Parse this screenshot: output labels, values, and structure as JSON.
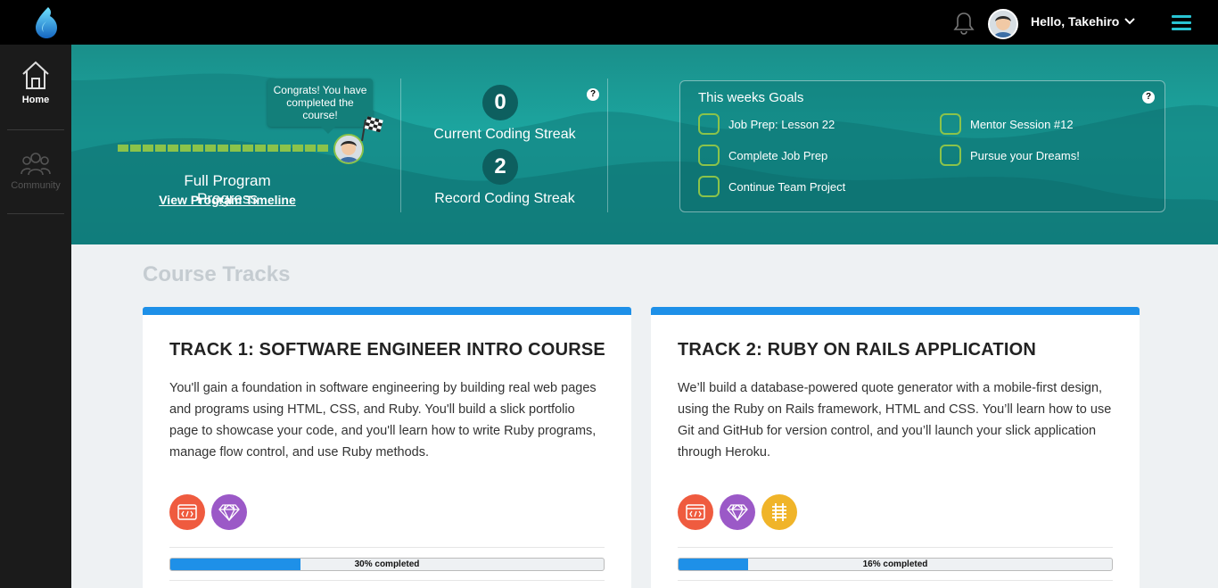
{
  "header": {
    "greeting": "Hello, Takehiro",
    "icons": [
      "logo-icon",
      "bell-icon",
      "chevron-down-icon",
      "hamburger-icon"
    ]
  },
  "sidebar": {
    "items": [
      {
        "label": "Home",
        "icon": "home-icon",
        "active": true
      },
      {
        "label": "Community",
        "icon": "community-icon",
        "active": false
      }
    ]
  },
  "hero": {
    "congrats": "Congrats! You have completed the course!",
    "program_progress_label": "Full Program Progress",
    "program_timeline_link": "View Program Timeline",
    "current_streak": {
      "value": "0",
      "label": "Current Coding Streak"
    },
    "record_streak": {
      "value": "2",
      "label": "Record Coding Streak"
    },
    "help": "?"
  },
  "goals": {
    "title": "This weeks Goals",
    "help": "?",
    "items": [
      {
        "label": "Job Prep: Lesson 22"
      },
      {
        "label": "Complete Job Prep"
      },
      {
        "label": "Continue Team Project"
      },
      {
        "label": "Mentor Session #12"
      },
      {
        "label": "Pursue your Dreams!"
      }
    ]
  },
  "course_tracks": {
    "title": "Course Tracks",
    "tracks": [
      {
        "title": "TRACK 1: SOFTWARE ENGINEER INTRO COURSE",
        "description": "You'll gain a foundation in software engineering by building real web pages and programs using HTML, CSS, and Ruby. You'll build a slick portfolio page to showcase your code, and you'll learn how to write Ruby programs, manage flow control, and use Ruby methods.",
        "badges": [
          "code-icon",
          "ruby-gem-icon"
        ],
        "progress": 0.3,
        "progress_label": "30% completed"
      },
      {
        "title": "TRACK 2: RUBY ON RAILS APPLICATION",
        "description": "We’ll build a database-powered quote generator with a mobile-first design, using the Ruby on Rails framework, HTML and CSS. You’ll learn how to use Git and GitHub for version control, and you’ll launch your slick application through Heroku.",
        "badges": [
          "code-icon",
          "ruby-gem-icon",
          "rails-icon"
        ],
        "progress": 0.16,
        "progress_label": "16% completed"
      }
    ]
  },
  "colors": {
    "accent": "#1e90e8",
    "teal": "#1ca6a0",
    "progress_green": "#8bc34a"
  }
}
